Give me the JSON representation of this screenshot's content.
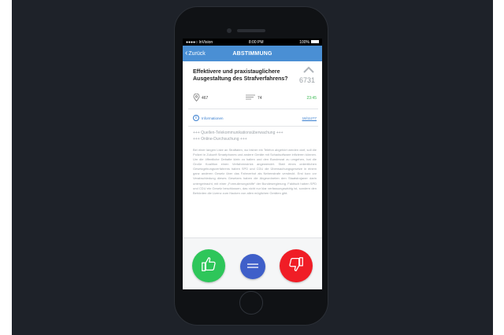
{
  "status_bar": {
    "carrier": "●●●●○ InVision",
    "time": "8:00 PM",
    "battery": "100%"
  },
  "nav": {
    "back_label": "Zurück",
    "title": "ABSTIMMUNG"
  },
  "question": {
    "title": "Effektivere und praxistauglichere Ausgestaltung des Strafverfahrens?",
    "votes": "6731"
  },
  "meta": {
    "location_count": "467",
    "comments_count": "74",
    "time_left": "23:45"
  },
  "info": {
    "label": "Informationen",
    "reference": "18/11277"
  },
  "tags": [
    "+++ Quellen-Telekommunikationsüberwachung +++",
    "+++ Online-Durchsuchung +++"
  ],
  "body_text": "Bei einer langen Liste an Straftaten, wo bisher ein Telefon abgehört werden darf, soll die Polizei in Zukunft Smartphones und andere Geräte mit Schadsoftware infizieren können. Um die öffentliche Debatte klein zu halten und den Bundesrat zu umgehen, hat die Große Koalition einen Verfahrenstrick angewendet. Statt eines ordentlichen Gesetzgebungsverfahrens haben SPD und CDU die Überwachungsgesetze in einem ganz anderen Gesetz über das Fahrverbot als Nebenstrafe versteckt. Erst kurz vor Verabschiedung dieses Gesetzes haben die Abgeordneten den Staatstrojaner darin untergebracht, mit einer „Formulierungshilfe“ der Bundesregierung. Faktisch haben SPD und CDU ein Gesetz beschlossen, das nicht nur klar verfassungswidrig ist, sondern den Behörden die Lizenz zum Hacken von allen möglichen Geräten gibt.",
  "colors": {
    "nav_blue": "#4a8fd4",
    "yes_green": "#2ec65a",
    "neutral_blue": "#3f5fc9",
    "no_red": "#f01d26",
    "timer_green": "#3dbb55"
  },
  "icons": {
    "back": "chevron-left-icon",
    "upvote": "chevron-up-icon",
    "location": "map-pin-icon",
    "comments": "lines-icon",
    "info": "info-icon",
    "yes": "thumbs-up-icon",
    "neutral": "equals-icon",
    "no": "thumbs-down-icon"
  }
}
